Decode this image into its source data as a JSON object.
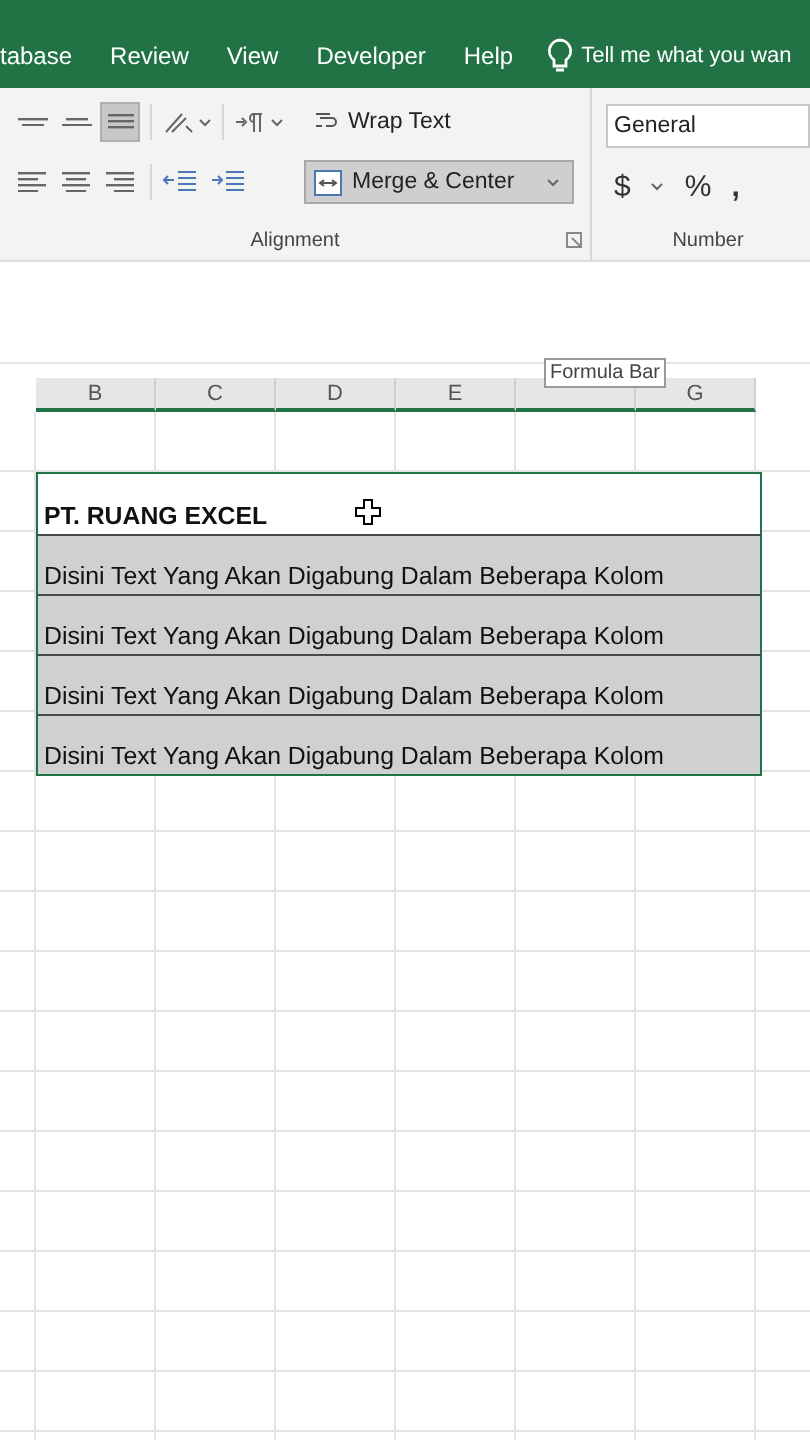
{
  "tabs": [
    {
      "label": "tabase",
      "selected": false
    },
    {
      "label": "Review",
      "selected": false
    },
    {
      "label": "View",
      "selected": false
    },
    {
      "label": "Developer",
      "selected": false
    },
    {
      "label": "Help",
      "selected": false
    }
  ],
  "tell_me": {
    "placeholder": "Tell me what you wan"
  },
  "alignment": {
    "label": "Alignment",
    "vertical": [
      {
        "kind": "top",
        "selected": false
      },
      {
        "kind": "middle",
        "selected": false
      },
      {
        "kind": "bottom",
        "selected": true
      }
    ],
    "horizontal": [
      {
        "kind": "left",
        "selected": false
      },
      {
        "kind": "center",
        "selected": false
      },
      {
        "kind": "right",
        "selected": false
      }
    ],
    "wrap_text": {
      "label": "Wrap Text",
      "selected": false
    },
    "merge_center": {
      "label": "Merge & Center",
      "selected": true
    }
  },
  "number": {
    "label": "Number",
    "format": "General",
    "currency": "$",
    "percent": "%",
    "comma": ","
  },
  "tooltip": "Formula Bar",
  "sheet": {
    "columns": [
      {
        "kind": "label",
        "label": "B"
      },
      {
        "kind": "label",
        "label": "C"
      },
      {
        "kind": "label",
        "label": "D"
      },
      {
        "kind": "label",
        "label": "E"
      },
      {
        "kind": "covered"
      },
      {
        "kind": "label",
        "label": "G"
      }
    ],
    "rows": [
      {
        "kind": "empty"
      },
      {
        "kind": "title",
        "text": "PT. RUANG EXCEL",
        "selected": true
      },
      {
        "kind": "merged",
        "text": "Disini Text Yang Akan Digabung Dalam Beberapa Kolom",
        "selected": true
      },
      {
        "kind": "merged",
        "text": "Disini Text Yang Akan Digabung Dalam Beberapa Kolom",
        "selected": true
      },
      {
        "kind": "merged",
        "text": "Disini Text Yang Akan Digabung Dalam Beberapa Kolom",
        "selected": true
      },
      {
        "kind": "merged",
        "text": "Disini Text Yang Akan Digabung Dalam Beberapa Kolom",
        "selected": true
      }
    ]
  }
}
